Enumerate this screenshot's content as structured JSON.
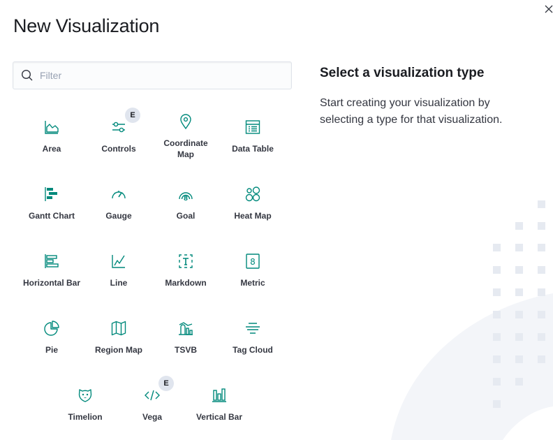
{
  "modal": {
    "title": "New Visualization",
    "close_icon": "close-icon"
  },
  "search": {
    "placeholder": "Filter",
    "value": "",
    "icon": "search-icon"
  },
  "side_panel": {
    "title": "Select a visualization type",
    "description": "Start creating your visualization by selecting a type for that visualization."
  },
  "colors": {
    "icon_teal": "#00897b",
    "text": "#343741",
    "title": "#1a1c21",
    "badge_bg": "#e0e5ee",
    "decoration": "#eef1f6"
  },
  "visualizations": [
    {
      "label": "Area",
      "icon": "area-chart-icon"
    },
    {
      "label": "Controls",
      "icon": "controls-icon",
      "badge": "E"
    },
    {
      "label": "Coordinate Map",
      "icon": "map-pin-icon"
    },
    {
      "label": "Data Table",
      "icon": "data-table-icon"
    },
    {
      "label": "Gantt Chart",
      "icon": "gantt-chart-icon"
    },
    {
      "label": "Gauge",
      "icon": "gauge-icon"
    },
    {
      "label": "Goal",
      "icon": "goal-icon"
    },
    {
      "label": "Heat Map",
      "icon": "heat-map-icon"
    },
    {
      "label": "Horizontal Bar",
      "icon": "horizontal-bar-icon"
    },
    {
      "label": "Line",
      "icon": "line-chart-icon"
    },
    {
      "label": "Markdown",
      "icon": "markdown-icon"
    },
    {
      "label": "Metric",
      "icon": "metric-icon"
    },
    {
      "label": "Pie",
      "icon": "pie-chart-icon"
    },
    {
      "label": "Region Map",
      "icon": "region-map-icon"
    },
    {
      "label": "TSVB",
      "icon": "tsvb-icon"
    },
    {
      "label": "Tag Cloud",
      "icon": "tag-cloud-icon"
    },
    {
      "label": "Timelion",
      "icon": "timelion-icon"
    },
    {
      "label": "Vega",
      "icon": "vega-code-icon",
      "badge": "E"
    },
    {
      "label": "Vertical Bar",
      "icon": "vertical-bar-icon"
    }
  ]
}
